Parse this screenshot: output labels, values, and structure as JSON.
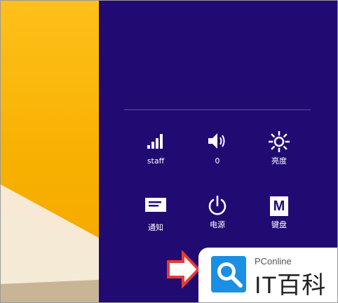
{
  "quick_settings": {
    "network": {
      "label": "staff",
      "icon": "signal-bars-icon"
    },
    "volume": {
      "label": "0",
      "icon": "speaker-icon"
    },
    "brightness": {
      "label": "亮度",
      "icon": "sun-icon"
    },
    "notifications": {
      "label": "通知",
      "icon": "notification-icon"
    },
    "power": {
      "label": "电源",
      "icon": "power-icon"
    },
    "keyboard": {
      "label": "键盘",
      "glyph": "M",
      "icon": "keyboard-icon"
    }
  },
  "watermark": {
    "brand_small": "PConline",
    "brand_big": "IT百科"
  },
  "colors": {
    "panel": "#220a73",
    "arrow": "#e53a3a",
    "wallpaper": "#f7b000",
    "watermark_blue": "#1a8fe3"
  }
}
